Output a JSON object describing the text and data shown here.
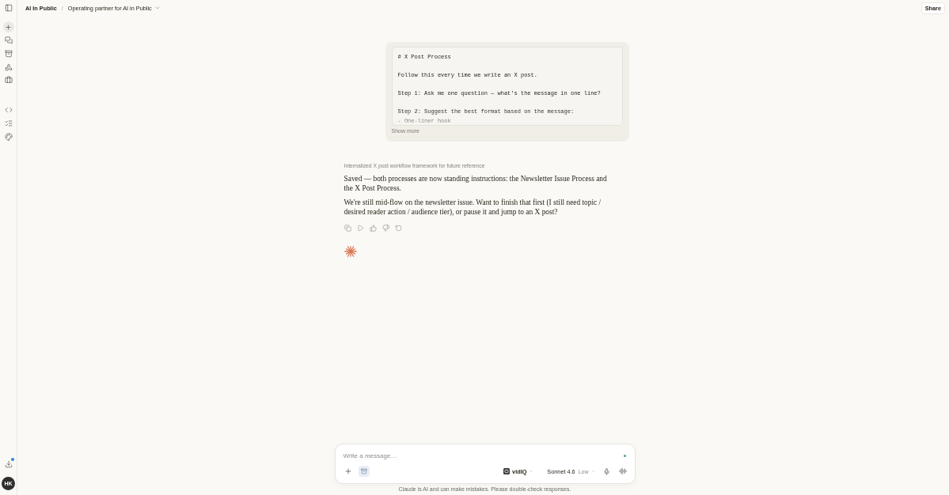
{
  "sidebar": {
    "downloads": {
      "notification": true
    },
    "user": {
      "initials": "HK"
    }
  },
  "header": {
    "project": "AI In Public",
    "separator": "/",
    "chat_title": "Operating partner for AI in Public",
    "share": "Share"
  },
  "user_message": {
    "code_blocks": [
      [
        "# X Post Process"
      ],
      [
        "Follow this every time we write an X post."
      ],
      [
        "Step 1: Ask me one question — what's the message in one line?"
      ],
      [
        "Step 2: Suggest the best format based on the message:",
        "- One-liner hook"
      ]
    ],
    "show_more": "Show more"
  },
  "response": {
    "summary": "Internalized X post workflow framework for future reference",
    "paragraphs": [
      "Saved — both processes are now standing instructions: the Newsletter Issue Process and the X Post Process.",
      "We're still mid-flow on the newsletter issue. Want to finish that first (I still need topic / desired reader action / audience tier), or pause it and jump to an X post?"
    ]
  },
  "composer": {
    "placeholder": "Write a message…",
    "project_toggle": {
      "on": true
    },
    "connector": "vidIQ",
    "model": "Sonnet 4.6",
    "effort": "Low"
  },
  "disclaimer": "Claude is AI and can make mistakes. Please double-check responses."
}
